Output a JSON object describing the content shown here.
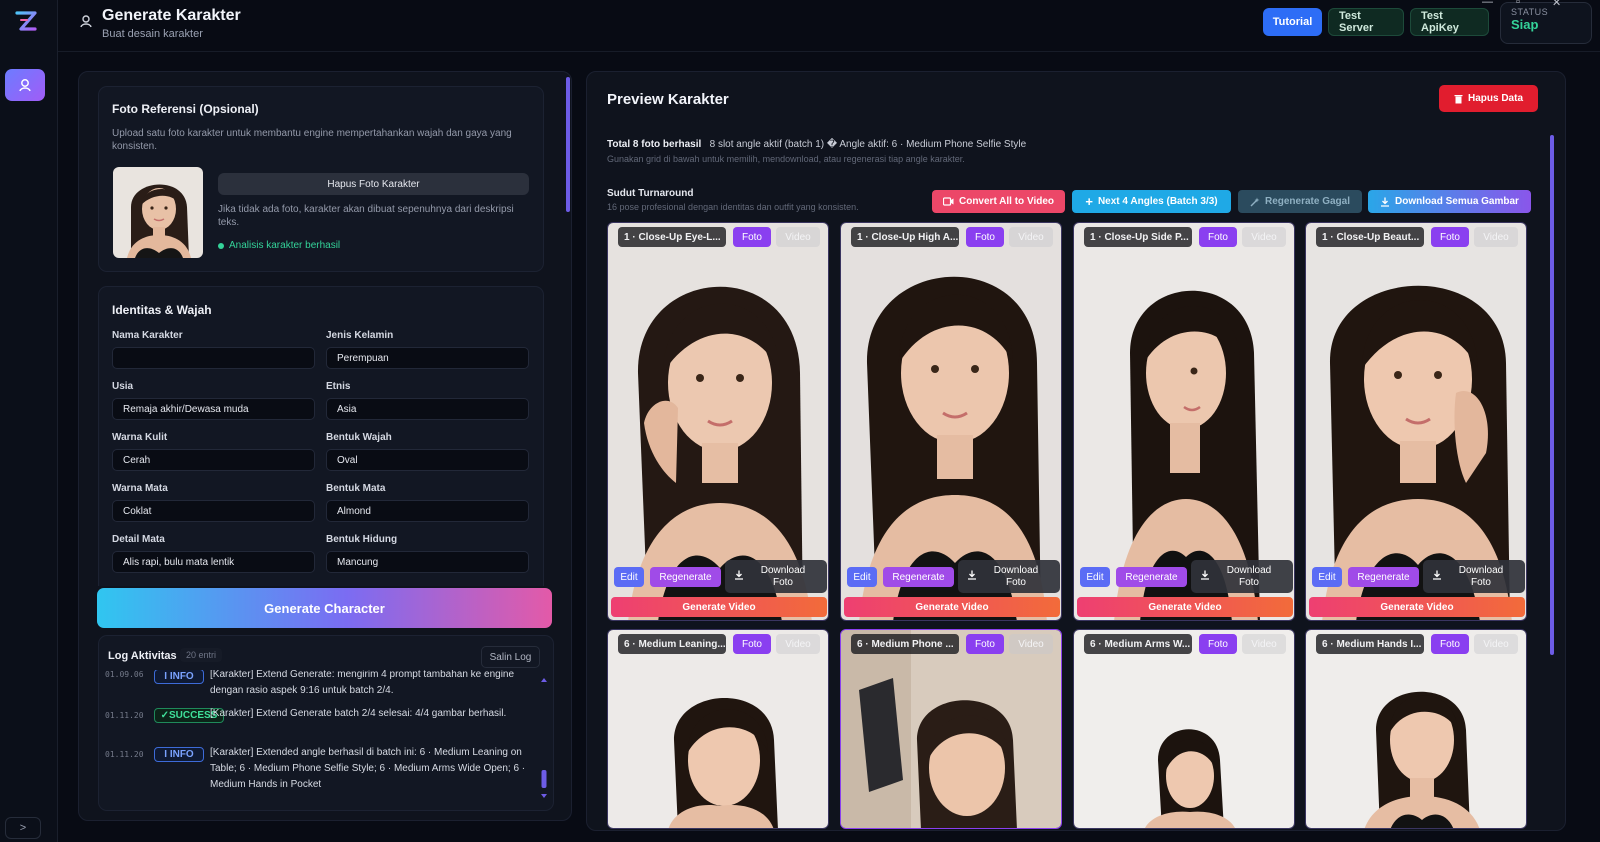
{
  "colors": {
    "accent": "#8a3ff0",
    "primary_blue": "#2d6df6",
    "success": "#34d399",
    "danger": "#e11d2e",
    "info": "#7aa2ff"
  },
  "header": {
    "title": "Generate Karakter",
    "subtitle": "Buat desain karakter",
    "tutorial": "Tutorial",
    "test_server": "Test Server",
    "test_apikey": "Test ApiKey",
    "status_label": "STATUS",
    "status_value": "Siap"
  },
  "rail": {
    "expand_label": ">"
  },
  "reference": {
    "title": "Foto Referensi (Opsional)",
    "desc": "Upload satu foto karakter untuk membantu engine mempertahankan wajah dan gaya yang konsisten.",
    "delete_button": "Hapus Foto Karakter",
    "note": "Jika tidak ada foto, karakter akan dibuat sepenuhnya dari deskripsi teks.",
    "analysis_status": "Analisis karakter berhasil"
  },
  "identity": {
    "title": "Identitas & Wajah",
    "fields": [
      {
        "label": "Nama Karakter",
        "value": ""
      },
      {
        "label": "Jenis Kelamin",
        "value": "Perempuan"
      },
      {
        "label": "Usia",
        "value": "Remaja akhir/Dewasa muda"
      },
      {
        "label": "Etnis",
        "value": "Asia"
      },
      {
        "label": "Warna Kulit",
        "value": "Cerah"
      },
      {
        "label": "Bentuk Wajah",
        "value": "Oval"
      },
      {
        "label": "Warna Mata",
        "value": "Coklat"
      },
      {
        "label": "Bentuk Mata",
        "value": "Almond"
      },
      {
        "label": "Detail Mata",
        "value": "Alis rapi, bulu mata lentik"
      },
      {
        "label": "Bentuk Hidung",
        "value": "Mancung"
      }
    ]
  },
  "generate_button": "Generate Character",
  "log": {
    "title": "Log Aktivitas",
    "count": "20 entri",
    "copy": "Salin Log",
    "entries": [
      {
        "time": "01.09.06",
        "level": "I INFO",
        "message": "[Karakter] Extend Generate: mengirim 4 prompt tambahan ke engine dengan rasio aspek 9:16 untuk batch 2/4."
      },
      {
        "time": "01.11.20",
        "level": "✓SUCCESS",
        "message": "[Karakter] Extend Generate batch 2/4 selesai: 4/4 gambar berhasil."
      },
      {
        "time": "01.11.20",
        "level": "I INFO",
        "message": "[Karakter] Extended angle berhasil di batch ini: 6 · Medium Leaning on Table; 6 · Medium Phone Selfie Style; 6 · Medium Arms Wide Open; 6 · Medium Hands in Pocket"
      }
    ]
  },
  "preview": {
    "title": "Preview Karakter",
    "delete_data": "Hapus Data",
    "summary_bold": "Total 8 foto berhasil",
    "summary_rest": "8 slot angle aktif (batch 1) � Angle aktif: 6 · Medium Phone Selfie Style",
    "summary_sub": "Gunakan grid di bawah untuk memilih, mendownload, atau regenerasi tiap angle karakter.",
    "section_title": "Sudut Turnaround",
    "section_sub": "16 pose profesional dengan identitas dan outfit yang konsisten.",
    "actions": {
      "convert": "Convert All to Video",
      "next": "Next 4 Angles (Batch 3/3)",
      "regen_failed": "Regenerate Gagal",
      "download_all": "Download Semua Gambar"
    },
    "tile_buttons": {
      "foto": "Foto",
      "video": "Video",
      "edit": "Edit",
      "regenerate": "Regenerate",
      "download": "Download Foto",
      "generate_video": "Generate Video"
    },
    "tiles": [
      {
        "label": "1 · Close-Up Eye-L..."
      },
      {
        "label": "1 · Close-Up High A..."
      },
      {
        "label": "1 · Close-Up Side P..."
      },
      {
        "label": "1 · Close-Up Beaut..."
      },
      {
        "label": "6 · Medium Leaning..."
      },
      {
        "label": "6 · Medium Phone ..."
      },
      {
        "label": "6 · Medium Arms W..."
      },
      {
        "label": "6 · Medium Hands I..."
      }
    ]
  }
}
